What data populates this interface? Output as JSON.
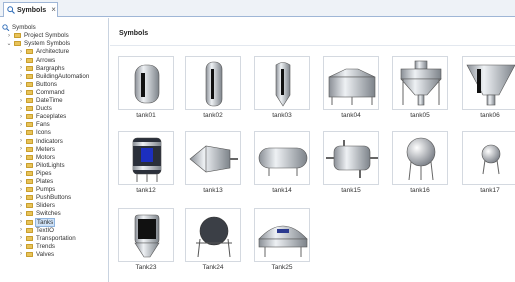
{
  "tab": {
    "label": "Symbols",
    "close": "×"
  },
  "tree": {
    "root": "Symbols",
    "items": [
      {
        "label": "Project Symbols",
        "chevron": "›",
        "level": 1
      },
      {
        "label": "System Symbols",
        "chevron": "⌄",
        "level": 1
      },
      {
        "label": "Architecture",
        "chevron": "›",
        "level": 2
      },
      {
        "label": "Arrows",
        "chevron": "›",
        "level": 2
      },
      {
        "label": "Bargraphs",
        "chevron": "›",
        "level": 2
      },
      {
        "label": "BuildingAutomation",
        "chevron": "›",
        "level": 2
      },
      {
        "label": "Buttons",
        "chevron": "›",
        "level": 2
      },
      {
        "label": "Command",
        "chevron": "›",
        "level": 2
      },
      {
        "label": "DateTime",
        "chevron": "›",
        "level": 2
      },
      {
        "label": "Ducts",
        "chevron": "›",
        "level": 2
      },
      {
        "label": "Faceplates",
        "chevron": "›",
        "level": 2
      },
      {
        "label": "Fans",
        "chevron": "›",
        "level": 2
      },
      {
        "label": "Icons",
        "chevron": "›",
        "level": 2
      },
      {
        "label": "Indicators",
        "chevron": "›",
        "level": 2
      },
      {
        "label": "Meters",
        "chevron": "›",
        "level": 2
      },
      {
        "label": "Motors",
        "chevron": "›",
        "level": 2
      },
      {
        "label": "PilotLights",
        "chevron": "›",
        "level": 2
      },
      {
        "label": "Pipes",
        "chevron": "›",
        "level": 2
      },
      {
        "label": "Plates",
        "chevron": "›",
        "level": 2
      },
      {
        "label": "Pumps",
        "chevron": "›",
        "level": 2
      },
      {
        "label": "PushButtons",
        "chevron": "›",
        "level": 2
      },
      {
        "label": "Sliders",
        "chevron": "›",
        "level": 2
      },
      {
        "label": "Switches",
        "chevron": "›",
        "level": 2
      },
      {
        "label": "Tanks",
        "chevron": "›",
        "level": 2,
        "selected": true
      },
      {
        "label": "TextIO",
        "chevron": "›",
        "level": 2
      },
      {
        "label": "Transportation",
        "chevron": "›",
        "level": 2
      },
      {
        "label": "Trends",
        "chevron": "›",
        "level": 2
      },
      {
        "label": "Valves",
        "chevron": "›",
        "level": 2
      }
    ]
  },
  "main": {
    "title": "Symbols",
    "symbols": [
      {
        "name": "tank01",
        "icon": "vertical-tank-icon"
      },
      {
        "name": "tank02",
        "icon": "tall-tank-icon"
      },
      {
        "name": "tank03",
        "icon": "cone-bottom-tank-icon"
      },
      {
        "name": "tank04",
        "icon": "silo-tank-icon"
      },
      {
        "name": "tank05",
        "icon": "cyclone-hopper-icon"
      },
      {
        "name": "tank06",
        "icon": "hopper-icon"
      },
      {
        "name": "tank12",
        "icon": "reactor-tank-icon"
      },
      {
        "name": "tank13",
        "icon": "conical-vessel-icon"
      },
      {
        "name": "tank14",
        "icon": "horizontal-tank-icon"
      },
      {
        "name": "tank15",
        "icon": "pressure-vessel-icon"
      },
      {
        "name": "tank16",
        "icon": "spherical-tank-icon"
      },
      {
        "name": "tank17",
        "icon": "small-sphere-tank-icon"
      },
      {
        "name": "Tank23",
        "icon": "cone-tank-icon"
      },
      {
        "name": "Tank24",
        "icon": "sphere-tank-icon"
      },
      {
        "name": "Tank25",
        "icon": "dome-tank-icon"
      }
    ]
  }
}
